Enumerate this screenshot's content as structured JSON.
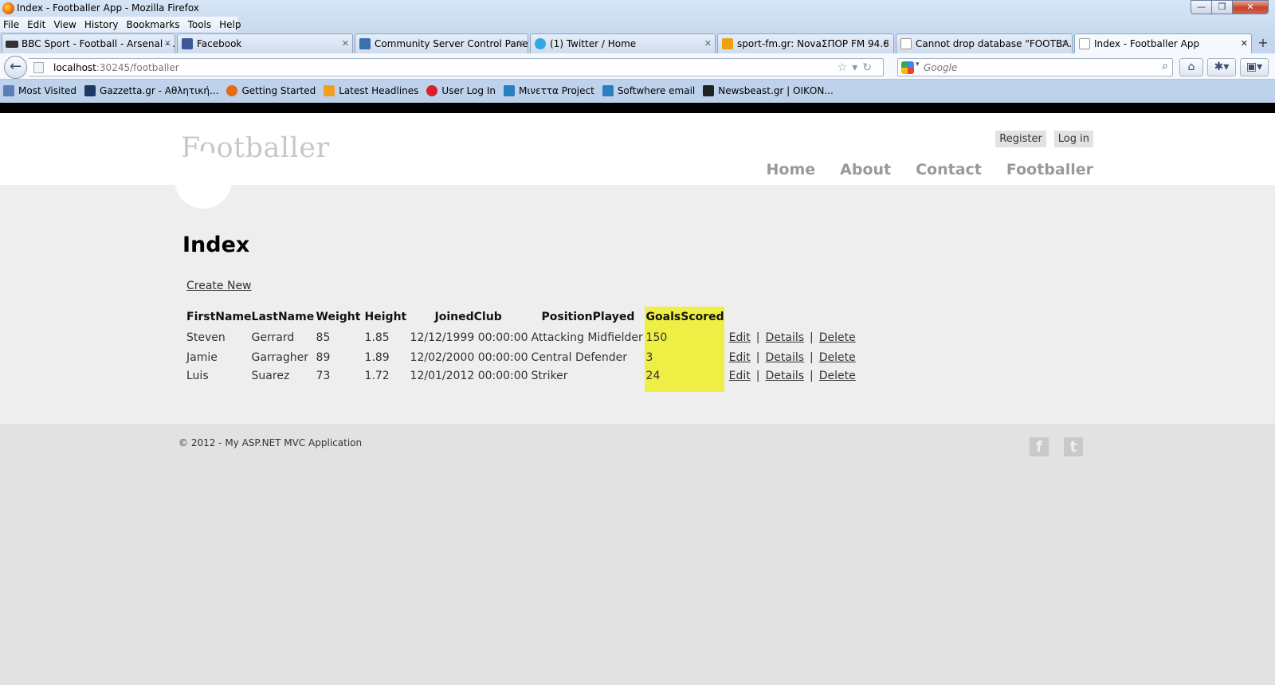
{
  "window": {
    "title": "Index - Footballer App - Mozilla Firefox",
    "min": "—",
    "max": "❐",
    "close": "✕"
  },
  "menu": [
    "File",
    "Edit",
    "View",
    "History",
    "Bookmarks",
    "Tools",
    "Help"
  ],
  "tabs": [
    {
      "label": "BBC Sport - Football - Arsenal - ...",
      "icon": "bbc-icon",
      "color": "#333333"
    },
    {
      "label": "Facebook",
      "icon": "facebook-icon",
      "color": "#3b5998"
    },
    {
      "label": "Community Server Control Panel",
      "icon": "aspnet-icon",
      "color": "#3a6fb0"
    },
    {
      "label": "(1) Twitter / Home",
      "icon": "twitter-icon",
      "color": "#2fa8e6"
    },
    {
      "label": "sport-fm.gr: NovaΣΠΟΡ FM 94.6",
      "icon": "sportfm-icon",
      "color": "#f0a010"
    },
    {
      "label": "Cannot drop database \"FOOTBA...",
      "icon": "page-icon",
      "color": "#ffffff"
    },
    {
      "label": "Index - Footballer App",
      "icon": "page-icon",
      "color": "#ffffff"
    }
  ],
  "new_tab": "+",
  "address": {
    "host": "localhost",
    "rest": ":30245/footballer"
  },
  "search": {
    "placeholder": "Google"
  },
  "bookmarks": [
    {
      "label": "Most Visited",
      "icon": "most-visited-icon",
      "color": "#5a7fb5"
    },
    {
      "label": "Gazzetta.gr - Αθλητική...",
      "icon": "gazzetta-icon",
      "color": "#1d3a66"
    },
    {
      "label": "Getting Started",
      "icon": "firefox-icon",
      "color": "#e86a0f"
    },
    {
      "label": "Latest Headlines",
      "icon": "rss-icon",
      "color": "#f0a020"
    },
    {
      "label": "User Log In",
      "icon": "user-login-icon",
      "color": "#d8202a"
    },
    {
      "label": "Μινεττα Project",
      "icon": "project-icon",
      "color": "#2a7fc0"
    },
    {
      "label": "Softwhere email",
      "icon": "email-icon",
      "color": "#2a7fc0"
    },
    {
      "label": "Newsbeast.gr | ΟΙΚΟΝ...",
      "icon": "newsbeast-icon",
      "color": "#222222"
    }
  ],
  "site": {
    "title": "Footballer",
    "register": "Register",
    "login": "Log in",
    "nav": [
      "Home",
      "About",
      "Contact",
      "Footballer"
    ]
  },
  "content": {
    "heading": "Index",
    "create_new": "Create New",
    "columns": [
      "FirstName",
      "LastName",
      "Weight",
      "Height",
      "JoinedClub",
      "PositionPlayed",
      "GoalsScored"
    ],
    "rows": [
      {
        "first": "Steven",
        "last": "Gerrard",
        "weight": "85",
        "height": "1.85",
        "joined": "12/12/1999 00:00:00",
        "position": "Attacking Midfielder",
        "goals": "150"
      },
      {
        "first": "Jamie",
        "last": "Garragher",
        "weight": "89",
        "height": "1.89",
        "joined": "12/02/2000 00:00:00",
        "position": "Central Defender",
        "goals": "3"
      },
      {
        "first": "Luis",
        "last": "Suarez",
        "weight": "73",
        "height": "1.72",
        "joined": "12/01/2012 00:00:00",
        "position": "Striker",
        "goals": "24"
      }
    ],
    "actions": {
      "edit": "Edit",
      "details": "Details",
      "delete": "Delete",
      "sep": "|"
    },
    "highlight_color": "#eeee44"
  },
  "footer": {
    "copyright": "© 2012 - My ASP.NET MVC Application",
    "facebook_glyph": "f",
    "twitter_glyph": "t"
  }
}
